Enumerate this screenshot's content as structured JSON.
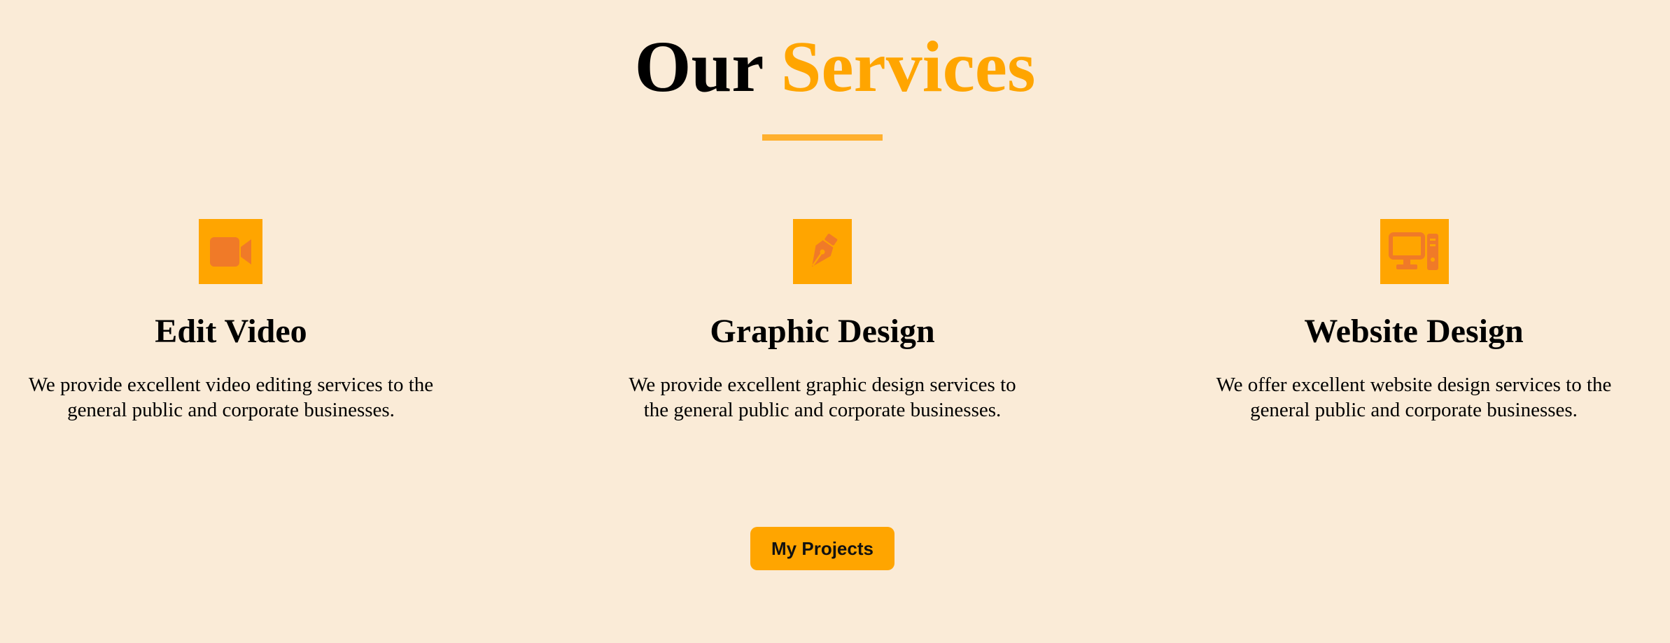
{
  "section": {
    "title_main": "Our",
    "title_accent": "Services"
  },
  "services": [
    {
      "icon": "video-camera-icon",
      "title": "Edit Video",
      "description": "We provide excellent video editing services to the general public and corporate businesses."
    },
    {
      "icon": "pen-nib-icon",
      "title": "Graphic Design",
      "description": "We provide excellent graphic design services to the general public and corporate businesses."
    },
    {
      "icon": "desktop-computer-icon",
      "title": "Website Design",
      "description": "We offer excellent website design services to the general public and corporate businesses."
    }
  ],
  "cta": {
    "label": "My Projects"
  },
  "colors": {
    "background": "#faebd7",
    "accent": "#ffa500",
    "icon": "#f07a28",
    "underline": "#ffb02e"
  }
}
